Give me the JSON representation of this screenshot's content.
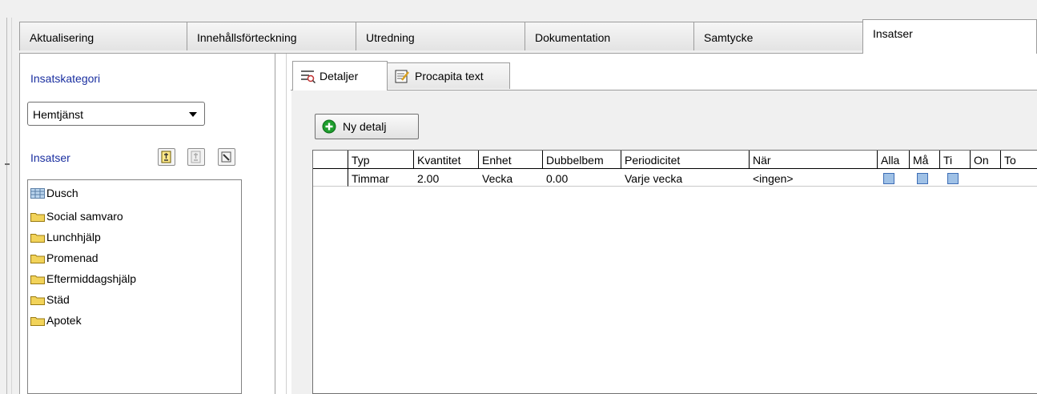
{
  "main_tabs": [
    {
      "label": "Aktualisering"
    },
    {
      "label": "Innehållsförteckning"
    },
    {
      "label": "Utredning"
    },
    {
      "label": "Dokumentation"
    },
    {
      "label": "Samtycke"
    },
    {
      "label": "Insatser",
      "active": true
    }
  ],
  "left": {
    "category_label": "Insatskategori",
    "category_value": "Hemtjänst",
    "insatser_label": "Insatser",
    "toolbar_icons": [
      "edit-icon",
      "edit-disabled-icon",
      "pencil-icon"
    ],
    "items": [
      {
        "label": "Dusch",
        "icon": "table-icon"
      },
      {
        "label": "Social samvaro",
        "icon": "folder-icon"
      },
      {
        "label": "Lunchhjälp",
        "icon": "folder-icon"
      },
      {
        "label": "Promenad",
        "icon": "folder-icon"
      },
      {
        "label": "Eftermiddagshjälp",
        "icon": "folder-icon"
      },
      {
        "label": "Städ",
        "icon": "folder-icon"
      },
      {
        "label": "Apotek",
        "icon": "folder-icon"
      }
    ]
  },
  "inner_tabs": [
    {
      "label": "Detaljer",
      "icon": "details-icon",
      "active": true
    },
    {
      "label": "Procapita text",
      "icon": "notepad-icon"
    }
  ],
  "new_button": {
    "label": "Ny detalj",
    "icon": "plus-circle-icon"
  },
  "grid": {
    "columns": [
      "Typ",
      "Kvantitet",
      "Enhet",
      "Dubbelbem",
      "Periodicitet",
      "När",
      "Alla",
      "Må",
      "Ti",
      "On",
      "To"
    ],
    "rows": [
      [
        "Timmar",
        "2.00",
        "Vecka",
        "0.00",
        "Varje vecka",
        "<ingen>"
      ]
    ],
    "checkbox_columns": [
      "Alla",
      "Må",
      "Ti"
    ]
  },
  "colors": {
    "accent_label": "#1a2fa0",
    "checkbox_fill": "#9fc1e6",
    "plus_green": "#1e9e2d"
  }
}
